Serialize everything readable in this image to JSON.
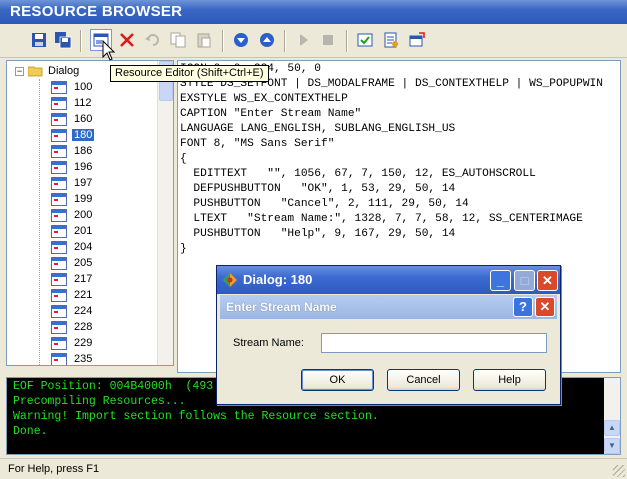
{
  "window": {
    "title": "RESOURCE BROWSER"
  },
  "toolbar": {
    "tooltip": "Resource Editor (Shift+Ctrl+E)",
    "buttons": [
      "save-icon",
      "save-all-icon",
      "resource-editor-icon",
      "delete-icon",
      "undo-icon",
      "copy-icon",
      "paste-icon",
      "move-down-icon",
      "move-up-icon",
      "run-icon",
      "stop-icon",
      "test-dialog-icon",
      "properties-icon",
      "export-icon"
    ]
  },
  "tree": {
    "root_label": "Dialog",
    "items": [
      "100",
      "112",
      "160",
      "180",
      "186",
      "196",
      "197",
      "199",
      "200",
      "201",
      "204",
      "205",
      "217",
      "221",
      "224",
      "228",
      "229",
      "235"
    ],
    "selected": "180"
  },
  "code": {
    "lines": [
      "ICON 0, 0, 224, 50, 0",
      "STYLE DS_SETFONT | DS_MODALFRAME | DS_CONTEXTHELP | WS_POPUPWIN",
      "EXSTYLE WS_EX_CONTEXTHELP",
      "CAPTION \"Enter Stream Name\"",
      "LANGUAGE LANG_ENGLISH, SUBLANG_ENGLISH_US",
      "FONT 8, \"MS Sans Serif\"",
      "{",
      "  EDITTEXT   \"\", 1056, 67, 7, 150, 12, ES_AUTOHSCROLL",
      "  DEFPUSHBUTTON   \"OK\", 1, 53, 29, 50, 14",
      "  PUSHBUTTON   \"Cancel\", 2, 111, 29, 50, 14",
      "  LTEXT   \"Stream Name:\", 1328, 7, 7, 58, 12, SS_CENTERIMAGE",
      "  PUSHBUTTON   \"Help\", 9, 167, 29, 50, 14",
      "}"
    ]
  },
  "preview": {
    "window_title": "Dialog: 180",
    "caption": "Enter Stream Name",
    "field_label": "Stream Name:",
    "field_value": "",
    "ok_label": "OK",
    "cancel_label": "Cancel",
    "help_label": "Help",
    "help_glyph": "?",
    "close_glyph": "✕",
    "minimize_glyph": "_",
    "maximize_glyph": "□"
  },
  "output": {
    "lines": [
      "EOF Position: 004B4000h  (493",
      "Precompiling Resources...",
      "Warning! Import section follows the Resource section.",
      "Done."
    ]
  },
  "status": {
    "text": "For Help, press F1"
  },
  "colors": {
    "title_bar": "#3a67c4",
    "selection": "#316ac5",
    "output_text": "#20e020",
    "output_bg": "#000000"
  }
}
